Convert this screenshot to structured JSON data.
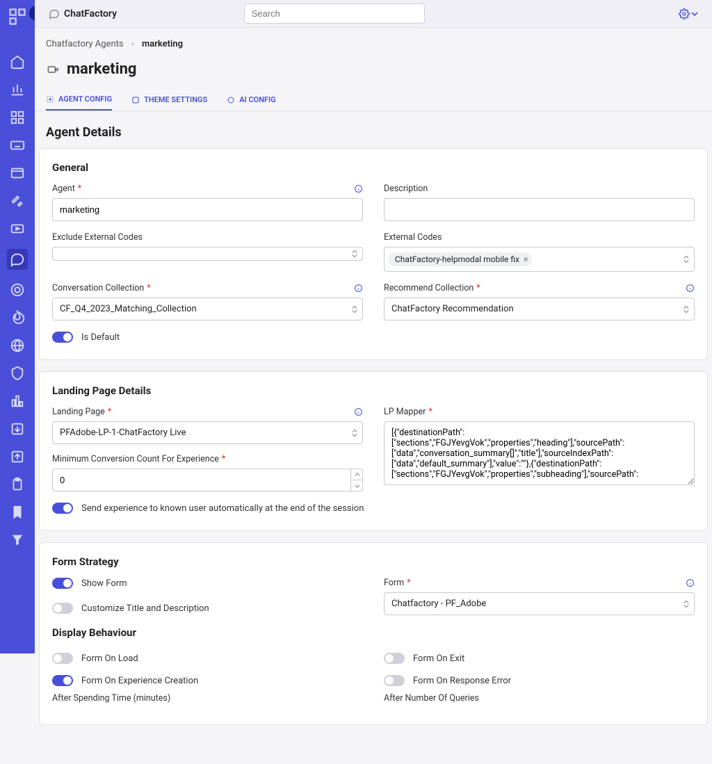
{
  "brand": "ChatFactory",
  "search_placeholder": "Search",
  "breadcrumb": {
    "items": [
      "Chatfactory Agents",
      "marketing"
    ]
  },
  "page_title": "marketing",
  "tabs": [
    {
      "id": "agent-config",
      "label": "AGENT CONFIG",
      "active": true
    },
    {
      "id": "theme-settings",
      "label": "THEME SETTINGS",
      "active": false
    },
    {
      "id": "ai-config",
      "label": "AI CONFIG",
      "active": false
    }
  ],
  "section_title": "Agent Details",
  "general": {
    "heading": "General",
    "agent_label": "Agent",
    "agent_value": "marketing",
    "description_label": "Description",
    "description_value": "",
    "exclude_external_codes_label": "Exclude External Codes",
    "exclude_external_codes_value": "",
    "external_codes_label": "External Codes",
    "external_codes_tag": "ChatFactory-helpmodal mobile fix",
    "conversation_collection_label": "Conversation Collection",
    "conversation_collection_value": "CF_Q4_2023_Matching_Collection",
    "recommend_collection_label": "Recommend Collection",
    "recommend_collection_value": "ChatFactory Recommendation",
    "is_default_label": "Is Default"
  },
  "landing": {
    "heading": "Landing Page Details",
    "landing_page_label": "Landing Page",
    "landing_page_value": "PFAdobe-LP-1-ChatFactory Live",
    "lp_mapper_label": "LP Mapper",
    "lp_mapper_value": "[{\"destinationPath\":[\"sections\",\"FGJYevgVok\",\"properties\",\"heading\"],\"sourcePath\":[\"data\",\"conversation_summary[]\",\"title\"],\"sourceIndexPath\":[\"data\",\"default_summary\"],\"value\":\"\"},{\"destinationPath\":[\"sections\",\"FGJYevgVok\",\"properties\",\"subheading\"],\"sourcePath\":",
    "min_conversion_label": "Minimum Conversion Count For Experience",
    "min_conversion_value": "0",
    "send_experience_label": "Send experience to known user automatically at the end of the session"
  },
  "form_strategy": {
    "heading": "Form Strategy",
    "show_form_label": "Show Form",
    "customize_label": "Customize Title and Description",
    "form_label": "Form",
    "form_value": "Chatfactory - PF_Adobe",
    "display_behaviour_heading": "Display Behaviour",
    "form_on_load_label": "Form On Load",
    "form_on_exit_label": "Form On Exit",
    "form_on_experience_label": "Form On Experience Creation",
    "form_on_response_error_label": "Form On Response Error",
    "after_spending_label": "After Spending Time (minutes)",
    "after_number_queries_label": "After Number Of Queries"
  }
}
